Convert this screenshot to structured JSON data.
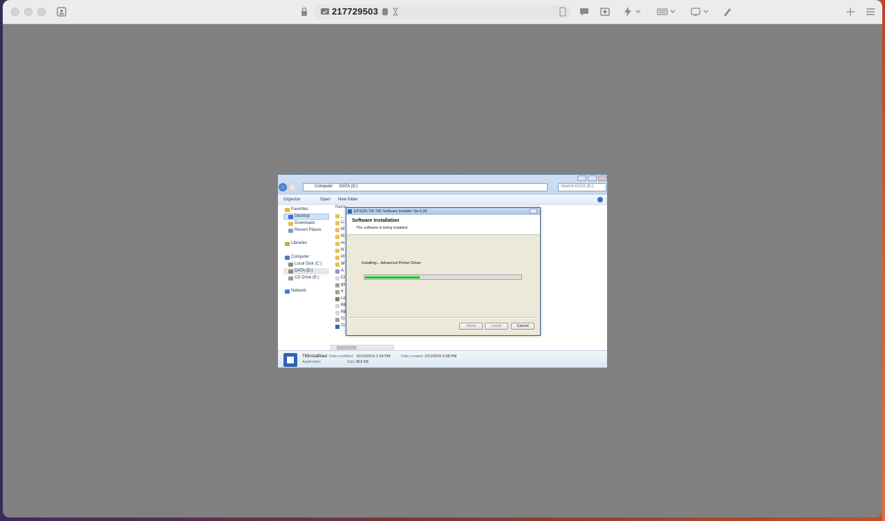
{
  "app": {
    "session_id": "217729503"
  },
  "explorer": {
    "breadcrumb": [
      "Computer",
      "DATA (D:)"
    ],
    "search_placeholder": "Search DATA (D:)",
    "commands": {
      "organize": "Organize",
      "open": "Open",
      "new_folder": "New folder"
    },
    "column_header": "Name",
    "nav": {
      "favorites": "Favorites",
      "desktop": "Desktop",
      "downloads": "Downloads",
      "recent_places": "Recent Places",
      "libraries": "Libraries",
      "computer": "Computer",
      "local_disk": "Local Disk (C:)",
      "data_drive": "DATA (D:)",
      "cd_drive": "CD Drive (E:)",
      "network": "Network"
    },
    "files": [
      "_",
      "Li",
      "M",
      "M",
      "m",
      "N",
      "Pr",
      "W",
      "A",
      "CI",
      "gs",
      "Ir",
      "Lo",
      "RE",
      "RE",
      "TI",
      "TI"
    ],
    "details": {
      "name": "TMInstallNavi",
      "type": "Application",
      "modified_label": "Date modified:",
      "modified_value": "10/15/2015 2:34 PM",
      "size_label": "Size:",
      "size_value": "863 KB",
      "created_label": "Date created:",
      "created_value": "2/21/2025 5:58 PM"
    }
  },
  "installer": {
    "title": "EPSON TM-T82 Software Installer Ver.6.00",
    "heading": "Software Installation",
    "subheading": "The software is being installed.",
    "status_text": "Installing...  Advanced Printer Driver",
    "progress": 0.35,
    "buttons": {
      "back": "<Back",
      "install": "Install",
      "cancel": "Cancel"
    }
  },
  "colors": {
    "accent": "#2ccc2c",
    "background": "#808080",
    "toolbar": "#ececec"
  }
}
